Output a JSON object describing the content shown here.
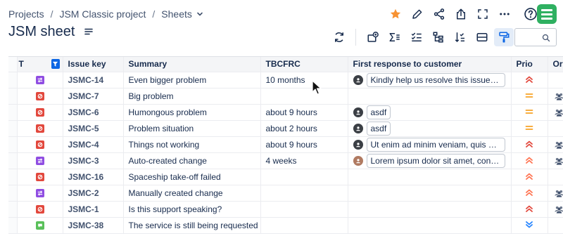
{
  "breadcrumb": {
    "items": [
      "Projects",
      "JSM Classic project",
      "Sheets"
    ],
    "separator": "/"
  },
  "page": {
    "title": "JSM sheet"
  },
  "colors": {
    "star": "#f79232",
    "logo": "#2fb061",
    "filter": "#0c66e4",
    "type_change": "#904ee2",
    "type_problem": "#e2483d",
    "type_request": "#5ac05a",
    "prio_highest": "#e2483d",
    "prio_high": "#ff7452",
    "prio_medium": "#f8a325",
    "prio_lowest": "#2684ff"
  },
  "top_actions": [
    "star-icon",
    "edit-icon",
    "share-icon",
    "export-icon",
    "fullscreen-icon",
    "more-icon",
    "help-icon"
  ],
  "toolbar": [
    "refresh-icon",
    "add-field-icon",
    "sum-icon",
    "checklist-icon",
    "hierarchy-icon",
    "sort-icon",
    "row-height-icon",
    "format-painter-icon",
    "search-icon"
  ],
  "table": {
    "columns": [
      "T",
      "Issue key",
      "Summary",
      "TBCFRC",
      "First response to customer",
      "Prio",
      "Org"
    ],
    "rows": [
      {
        "type": "change",
        "key": "JSMC-14",
        "summary": "Even bigger problem",
        "tbcfrc": "10 months",
        "response": "Kindly help us resolve this issue please",
        "avatar": "dark",
        "prio": "highest",
        "org": false
      },
      {
        "type": "problem",
        "key": "JSMC-7",
        "summary": "Big problem",
        "tbcfrc": "",
        "response": "",
        "avatar": "",
        "prio": "medium",
        "org": true
      },
      {
        "type": "problem",
        "key": "JSMC-6",
        "summary": "Humongous problem",
        "tbcfrc": "about 9 hours",
        "response": "asdf",
        "avatar": "dark",
        "prio": "medium",
        "org": true
      },
      {
        "type": "problem",
        "key": "JSMC-5",
        "summary": "Problem situation",
        "tbcfrc": "about 2 hours",
        "response": "asdf",
        "avatar": "dark",
        "prio": "medium",
        "org": false
      },
      {
        "type": "problem",
        "key": "JSMC-4",
        "summary": "Things not working",
        "tbcfrc": "about 9 hours",
        "response": "Ut enim ad minim veniam, quis nostrud",
        "avatar": "dark",
        "prio": "highest",
        "org": true
      },
      {
        "type": "change",
        "key": "JSMC-3",
        "summary": "Auto-created change",
        "tbcfrc": "4 weeks",
        "response": "Lorem ipsum dolor sit amet, consectetur",
        "avatar": "alt",
        "prio": "high",
        "org": true
      },
      {
        "type": "problem",
        "key": "JSMC-16",
        "summary": "Spaceship take-off failed",
        "tbcfrc": "",
        "response": "",
        "avatar": "",
        "prio": "high",
        "org": false
      },
      {
        "type": "change",
        "key": "JSMC-2",
        "summary": "Manually created change",
        "tbcfrc": "",
        "response": "",
        "avatar": "",
        "prio": "high",
        "org": true
      },
      {
        "type": "problem",
        "key": "JSMC-1",
        "summary": "Is this support speaking?",
        "tbcfrc": "",
        "response": "",
        "avatar": "",
        "prio": "highest",
        "org": true
      },
      {
        "type": "request",
        "key": "JSMC-38",
        "summary": "The service is still being requested",
        "tbcfrc": "",
        "response": "",
        "avatar": "",
        "prio": "lowest",
        "org": false
      }
    ]
  }
}
